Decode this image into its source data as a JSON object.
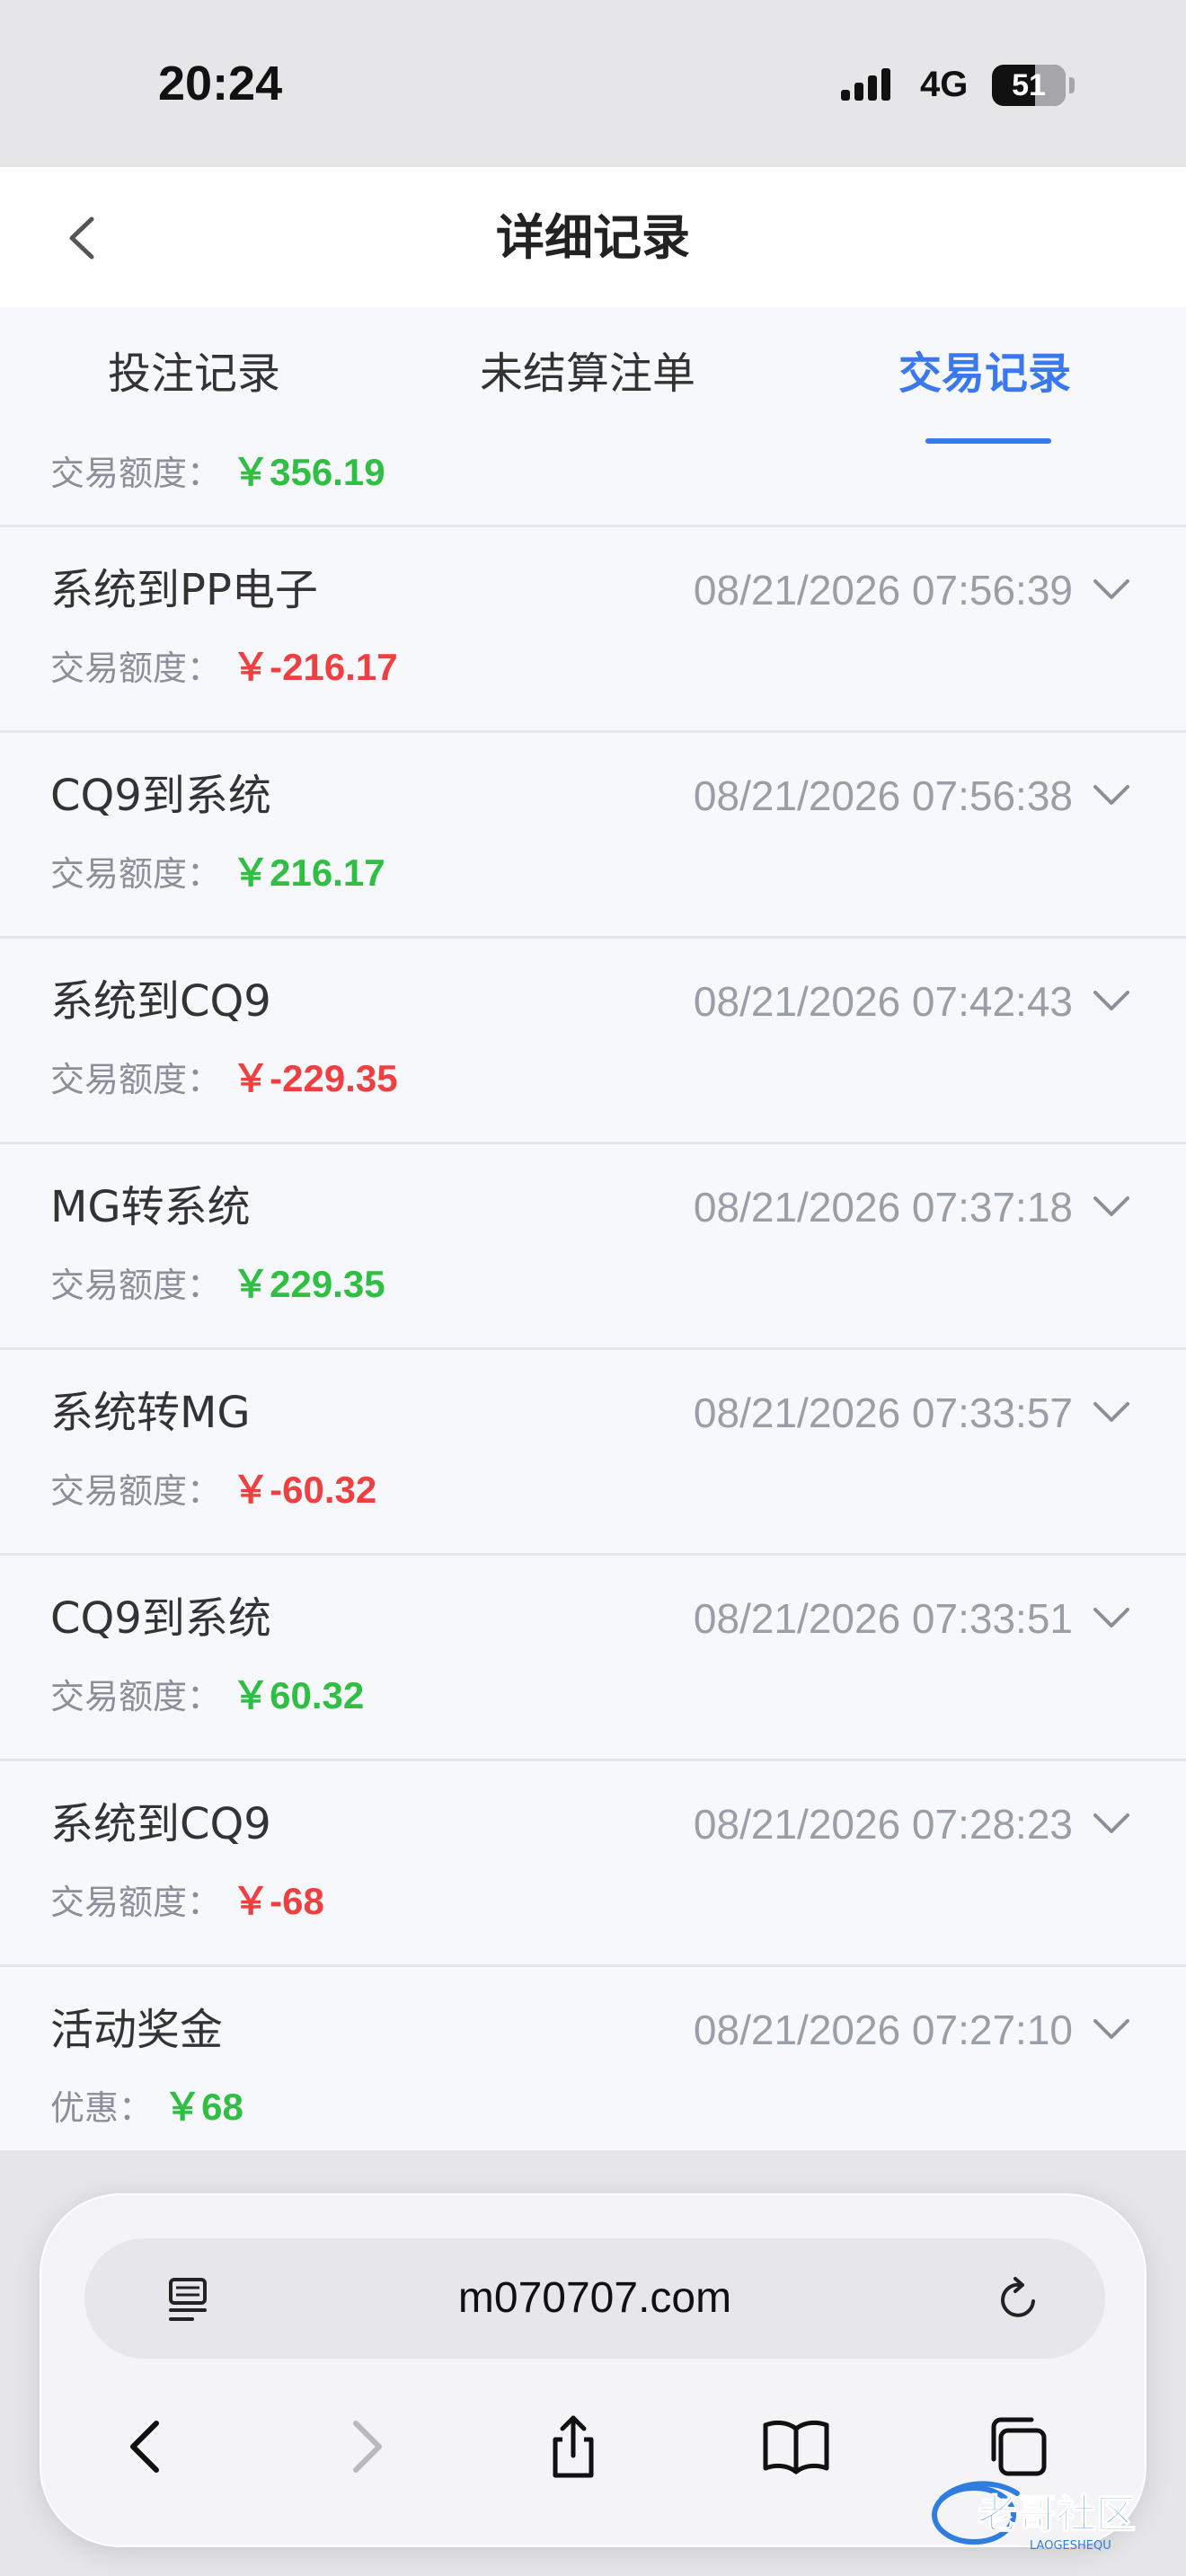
{
  "status_bar": {
    "time": "20:24",
    "network": "4G",
    "battery": "51",
    "battery_level": 0.51
  },
  "header": {
    "title": "详细记录"
  },
  "tabs": [
    {
      "label": "投注记录",
      "active": false
    },
    {
      "label": "未结算注单",
      "active": false
    },
    {
      "label": "交易记录",
      "active": true
    }
  ],
  "partial_row": {
    "label": "交易额度：",
    "amount": "￥356.19"
  },
  "records": [
    {
      "title": "系统到PP电子",
      "time": "08/21/2026 07:56:39",
      "label": "交易额度：",
      "amount": "￥-216.17",
      "sign": "neg"
    },
    {
      "title": "CQ9到系统",
      "time": "08/21/2026 07:56:38",
      "label": "交易额度：",
      "amount": "￥216.17",
      "sign": "pos"
    },
    {
      "title": "系统到CQ9",
      "time": "08/21/2026 07:42:43",
      "label": "交易额度：",
      "amount": "￥-229.35",
      "sign": "neg"
    },
    {
      "title": "MG转系统",
      "time": "08/21/2026 07:37:18",
      "label": "交易额度：",
      "amount": "￥229.35",
      "sign": "pos"
    },
    {
      "title": "系统转MG",
      "time": "08/21/2026 07:33:57",
      "label": "交易额度：",
      "amount": "￥-60.32",
      "sign": "neg"
    },
    {
      "title": "CQ9到系统",
      "time": "08/21/2026 07:33:51",
      "label": "交易额度：",
      "amount": "￥60.32",
      "sign": "pos"
    },
    {
      "title": "系统到CQ9",
      "time": "08/21/2026 07:28:23",
      "label": "交易额度：",
      "amount": "￥-68",
      "sign": "neg"
    },
    {
      "title": "活动奖金",
      "time": "08/21/2026 07:27:10",
      "label": "优惠：",
      "amount": "￥68",
      "sign": "pos"
    }
  ],
  "browser": {
    "url": "m070707.com",
    "icons": [
      "reader-icon",
      "reload-icon",
      "back-icon",
      "forward-icon",
      "share-icon",
      "bookmarks-icon",
      "tabs-icon"
    ]
  },
  "watermark": {
    "text": "老哥社区",
    "subtext": "LAOGESHEQU"
  },
  "colors": {
    "accent": "#3a78f0",
    "positive": "#2fbf42",
    "negative": "#ee4040"
  }
}
